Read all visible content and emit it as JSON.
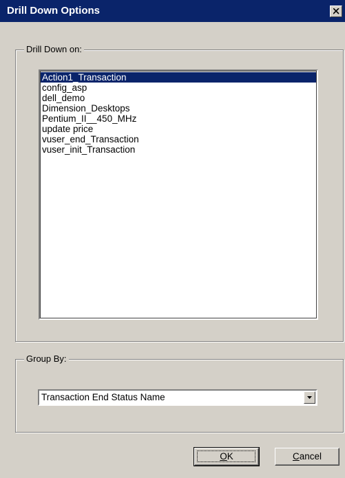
{
  "window": {
    "title": "Drill Down Options"
  },
  "drill_down": {
    "legend": "Drill Down on:",
    "items": [
      "Action1_Transaction",
      "config_asp",
      "dell_demo",
      "Dimension_Desktops",
      "Pentium_II__450_MHz",
      "update price",
      "vuser_end_Transaction",
      "vuser_init_Transaction"
    ],
    "selected": "Action1_Transaction"
  },
  "group_by": {
    "legend": "Group By:",
    "value": "Transaction End Status Name"
  },
  "buttons": {
    "ok_mnemonic": "O",
    "ok_rest": "K",
    "cancel_mnemonic": "C",
    "cancel_rest": "ancel"
  },
  "icons": {
    "close": "close-icon",
    "dropdown": "chevron-down-icon"
  },
  "colors": {
    "titlebar": "#0a246a",
    "selection": "#0a246a",
    "face": "#d4d0c8"
  }
}
